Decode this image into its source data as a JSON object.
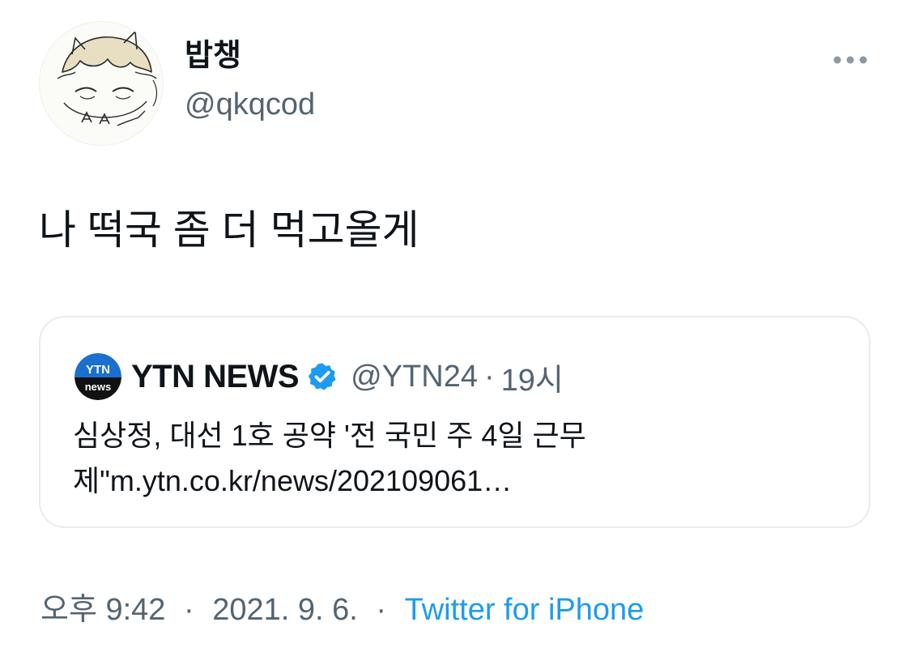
{
  "author": {
    "display_name": "밥챙",
    "handle": "@qkqcod"
  },
  "tweet": {
    "text": "나 떡국 좀 더 먹고올게"
  },
  "quoted_tweet": {
    "avatar_text_top": "YTN",
    "avatar_text_bottom": "news",
    "name": "YTN NEWS",
    "handle": "@YTN24",
    "separator": "·",
    "time": "19시",
    "body_line1": "심상정, 대선 1호 공약 '전 국민 주 4일 근무",
    "body_line2": "제\"m.ytn.co.kr/news/202109061…"
  },
  "meta": {
    "time": "오후 9:42",
    "date": "2021. 9. 6.",
    "separator": "·",
    "source": "Twitter for iPhone"
  },
  "colors": {
    "link": "#1d9bf0",
    "secondary_text": "#536471",
    "verified": "#1d9bf0",
    "ytn_blue": "#1b6fd0"
  },
  "icons": {
    "more": "more-horizontal-icon",
    "verified": "verified-badge-icon"
  }
}
